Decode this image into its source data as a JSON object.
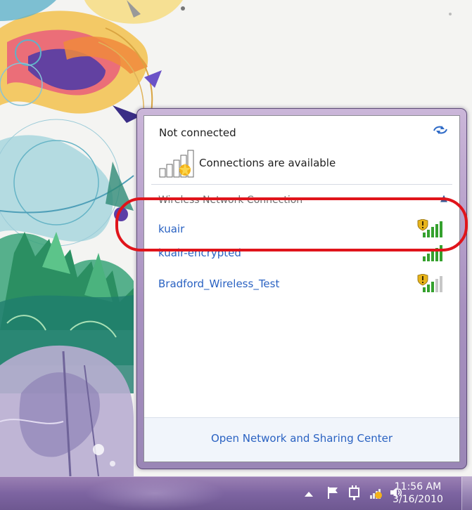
{
  "flyout": {
    "status_title": "Not connected",
    "refresh_icon": "refresh-arrows-icon",
    "availability_text": "Connections are available",
    "section_title": "Wireless Network Connection",
    "collapse_glyph": "^",
    "networks": [
      {
        "name": "kuair",
        "secured": true,
        "signal_bars": 5,
        "highlighted": true
      },
      {
        "name": "kuair-encrypted",
        "secured": false,
        "signal_bars": 5,
        "highlighted": false
      },
      {
        "name": "Bradford_Wireless_Test",
        "secured": true,
        "signal_bars": 3,
        "highlighted": false
      }
    ],
    "footer_link": "Open Network and Sharing Center"
  },
  "taskbar": {
    "tray_icons": [
      "show-hidden-icons-arrow",
      "action-center-flag-icon",
      "power-plug-icon",
      "network-warning-icon",
      "volume-icon"
    ],
    "clock_time": "11:56 AM",
    "clock_date": "3/16/2010"
  },
  "colors": {
    "link_blue": "#2a62c2",
    "highlight_red": "#e0141b",
    "taskbar_purple": "#7d64a1",
    "flyout_frame": "#a891c0"
  }
}
